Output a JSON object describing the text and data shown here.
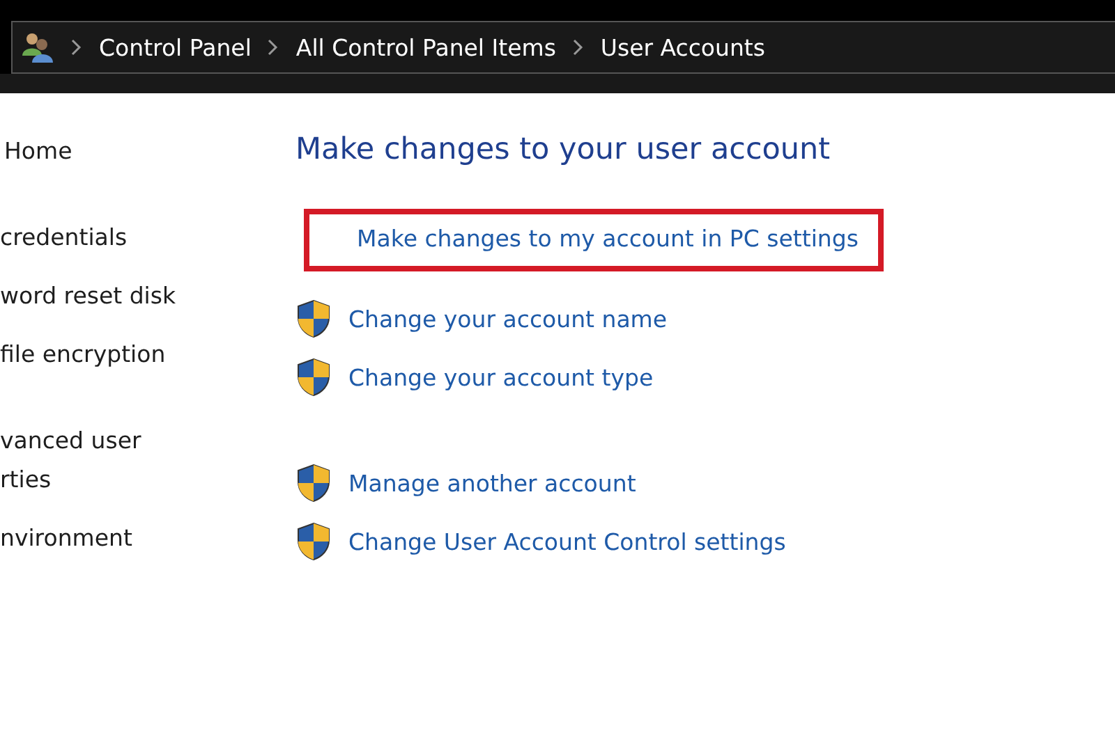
{
  "breadcrumb": [
    "Control Panel",
    "All Control Panel Items",
    "User Accounts"
  ],
  "sidebar": {
    "groups": [
      [
        "Home"
      ],
      [
        "credentials",
        "word reset disk",
        "file encryption"
      ],
      [
        "vanced user\nrties",
        "nvironment"
      ]
    ]
  },
  "main": {
    "title": "Make changes to your user account",
    "groups": [
      [
        {
          "label": "Make changes to my account in PC settings",
          "shield": false,
          "highlighted": true
        }
      ],
      [
        {
          "label": "Change your account name",
          "shield": true,
          "highlighted": false
        },
        {
          "label": "Change your account type",
          "shield": true,
          "highlighted": false
        }
      ],
      [
        {
          "label": "Manage another account",
          "shield": true,
          "highlighted": false
        },
        {
          "label": "Change User Account Control settings",
          "shield": true,
          "highlighted": false
        }
      ]
    ]
  }
}
